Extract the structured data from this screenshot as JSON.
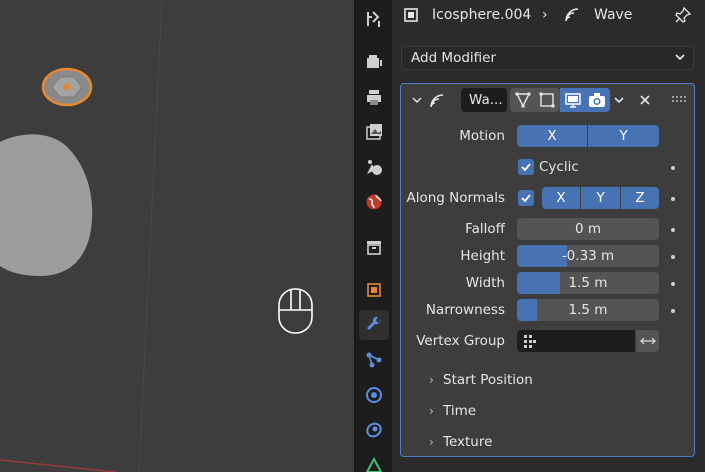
{
  "header": {
    "object_name": "Icosphere.004",
    "modifier_name": "Wave"
  },
  "add_modifier": {
    "label": "Add Modifier"
  },
  "modifier": {
    "name_short": "Wa...",
    "motion": {
      "label": "Motion",
      "x": "X",
      "y": "Y"
    },
    "cyclic": {
      "label": "Cyclic",
      "checked": true
    },
    "along_normals": {
      "label": "Along Normals",
      "checked": true,
      "x": "X",
      "y": "Y",
      "z": "Z"
    },
    "falloff": {
      "label": "Falloff",
      "value": "0 m"
    },
    "height": {
      "label": "Height",
      "value": "-0.33 m",
      "fill": 0.35
    },
    "width": {
      "label": "Width",
      "value": "1.5 m",
      "fill": 0.3
    },
    "narrowness": {
      "label": "Narrowness",
      "value": "1.5 m",
      "fill": 0.14
    },
    "vertex_group": {
      "label": "Vertex Group",
      "value": ""
    },
    "subpanels": [
      "Start Position",
      "Time",
      "Texture"
    ]
  },
  "colors": {
    "accent": "#4772b3",
    "selection_outline": "#e8892f",
    "panel_border": "#4e7fc8"
  }
}
